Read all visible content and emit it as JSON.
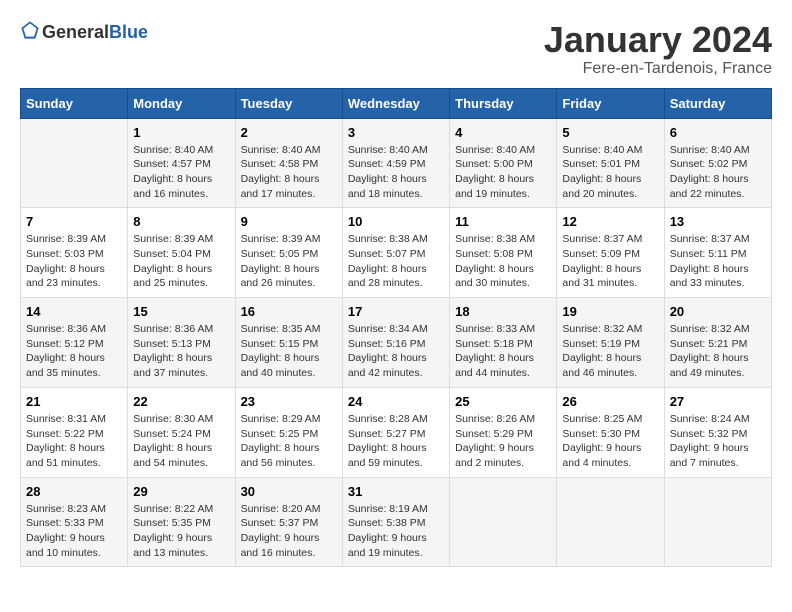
{
  "header": {
    "logo": {
      "text_general": "General",
      "text_blue": "Blue"
    },
    "title": "January 2024",
    "subtitle": "Fere-en-Tardenois, France"
  },
  "calendar": {
    "days_of_week": [
      "Sunday",
      "Monday",
      "Tuesday",
      "Wednesday",
      "Thursday",
      "Friday",
      "Saturday"
    ],
    "weeks": [
      [
        {
          "day": "",
          "info": ""
        },
        {
          "day": "1",
          "info": "Sunrise: 8:40 AM\nSunset: 4:57 PM\nDaylight: 8 hours\nand 16 minutes."
        },
        {
          "day": "2",
          "info": "Sunrise: 8:40 AM\nSunset: 4:58 PM\nDaylight: 8 hours\nand 17 minutes."
        },
        {
          "day": "3",
          "info": "Sunrise: 8:40 AM\nSunset: 4:59 PM\nDaylight: 8 hours\nand 18 minutes."
        },
        {
          "day": "4",
          "info": "Sunrise: 8:40 AM\nSunset: 5:00 PM\nDaylight: 8 hours\nand 19 minutes."
        },
        {
          "day": "5",
          "info": "Sunrise: 8:40 AM\nSunset: 5:01 PM\nDaylight: 8 hours\nand 20 minutes."
        },
        {
          "day": "6",
          "info": "Sunrise: 8:40 AM\nSunset: 5:02 PM\nDaylight: 8 hours\nand 22 minutes."
        }
      ],
      [
        {
          "day": "7",
          "info": "Sunrise: 8:39 AM\nSunset: 5:03 PM\nDaylight: 8 hours\nand 23 minutes."
        },
        {
          "day": "8",
          "info": "Sunrise: 8:39 AM\nSunset: 5:04 PM\nDaylight: 8 hours\nand 25 minutes."
        },
        {
          "day": "9",
          "info": "Sunrise: 8:39 AM\nSunset: 5:05 PM\nDaylight: 8 hours\nand 26 minutes."
        },
        {
          "day": "10",
          "info": "Sunrise: 8:38 AM\nSunset: 5:07 PM\nDaylight: 8 hours\nand 28 minutes."
        },
        {
          "day": "11",
          "info": "Sunrise: 8:38 AM\nSunset: 5:08 PM\nDaylight: 8 hours\nand 30 minutes."
        },
        {
          "day": "12",
          "info": "Sunrise: 8:37 AM\nSunset: 5:09 PM\nDaylight: 8 hours\nand 31 minutes."
        },
        {
          "day": "13",
          "info": "Sunrise: 8:37 AM\nSunset: 5:11 PM\nDaylight: 8 hours\nand 33 minutes."
        }
      ],
      [
        {
          "day": "14",
          "info": "Sunrise: 8:36 AM\nSunset: 5:12 PM\nDaylight: 8 hours\nand 35 minutes."
        },
        {
          "day": "15",
          "info": "Sunrise: 8:36 AM\nSunset: 5:13 PM\nDaylight: 8 hours\nand 37 minutes."
        },
        {
          "day": "16",
          "info": "Sunrise: 8:35 AM\nSunset: 5:15 PM\nDaylight: 8 hours\nand 40 minutes."
        },
        {
          "day": "17",
          "info": "Sunrise: 8:34 AM\nSunset: 5:16 PM\nDaylight: 8 hours\nand 42 minutes."
        },
        {
          "day": "18",
          "info": "Sunrise: 8:33 AM\nSunset: 5:18 PM\nDaylight: 8 hours\nand 44 minutes."
        },
        {
          "day": "19",
          "info": "Sunrise: 8:32 AM\nSunset: 5:19 PM\nDaylight: 8 hours\nand 46 minutes."
        },
        {
          "day": "20",
          "info": "Sunrise: 8:32 AM\nSunset: 5:21 PM\nDaylight: 8 hours\nand 49 minutes."
        }
      ],
      [
        {
          "day": "21",
          "info": "Sunrise: 8:31 AM\nSunset: 5:22 PM\nDaylight: 8 hours\nand 51 minutes."
        },
        {
          "day": "22",
          "info": "Sunrise: 8:30 AM\nSunset: 5:24 PM\nDaylight: 8 hours\nand 54 minutes."
        },
        {
          "day": "23",
          "info": "Sunrise: 8:29 AM\nSunset: 5:25 PM\nDaylight: 8 hours\nand 56 minutes."
        },
        {
          "day": "24",
          "info": "Sunrise: 8:28 AM\nSunset: 5:27 PM\nDaylight: 8 hours\nand 59 minutes."
        },
        {
          "day": "25",
          "info": "Sunrise: 8:26 AM\nSunset: 5:29 PM\nDaylight: 9 hours\nand 2 minutes."
        },
        {
          "day": "26",
          "info": "Sunrise: 8:25 AM\nSunset: 5:30 PM\nDaylight: 9 hours\nand 4 minutes."
        },
        {
          "day": "27",
          "info": "Sunrise: 8:24 AM\nSunset: 5:32 PM\nDaylight: 9 hours\nand 7 minutes."
        }
      ],
      [
        {
          "day": "28",
          "info": "Sunrise: 8:23 AM\nSunset: 5:33 PM\nDaylight: 9 hours\nand 10 minutes."
        },
        {
          "day": "29",
          "info": "Sunrise: 8:22 AM\nSunset: 5:35 PM\nDaylight: 9 hours\nand 13 minutes."
        },
        {
          "day": "30",
          "info": "Sunrise: 8:20 AM\nSunset: 5:37 PM\nDaylight: 9 hours\nand 16 minutes."
        },
        {
          "day": "31",
          "info": "Sunrise: 8:19 AM\nSunset: 5:38 PM\nDaylight: 9 hours\nand 19 minutes."
        },
        {
          "day": "",
          "info": ""
        },
        {
          "day": "",
          "info": ""
        },
        {
          "day": "",
          "info": ""
        }
      ]
    ]
  }
}
